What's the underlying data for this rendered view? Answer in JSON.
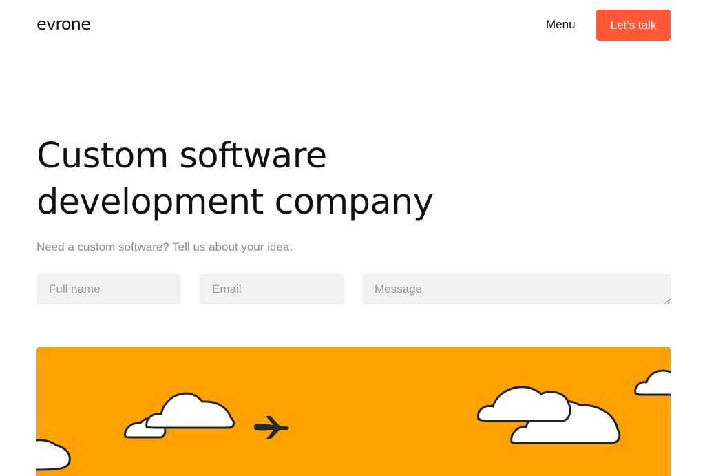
{
  "header": {
    "logo_text": "evrone",
    "menu_label": "Menu",
    "cta_label": "Let’s talk"
  },
  "hero": {
    "title_line_1": "Custom software",
    "title_line_2": "development company",
    "subtitle": "Need a custom software? Tell us about your idea:"
  },
  "form": {
    "name_placeholder": "Full name",
    "email_placeholder": "Email",
    "message_placeholder": "Message"
  },
  "colors": {
    "brand_accent": "#ff5a35",
    "illustration_background": "#ffa200",
    "field_background": "#f1f1f1",
    "text_primary": "#111111",
    "text_secondary": "#8b8b8b"
  },
  "illustration": {
    "icons": [
      "cloud-icon",
      "airplane-icon"
    ]
  }
}
